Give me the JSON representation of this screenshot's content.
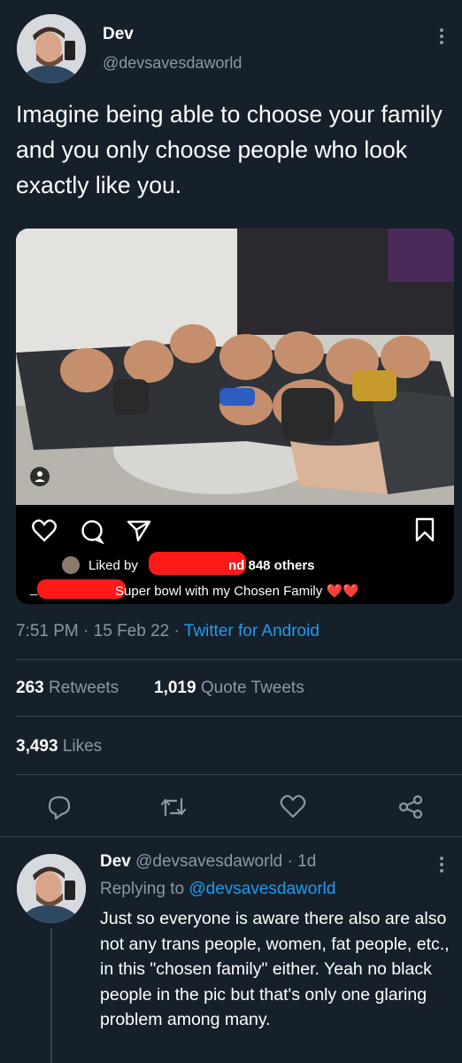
{
  "colors": {
    "background": "#15202b",
    "text": "#ffffff",
    "muted": "#8b98a5",
    "link": "#1d9bf0",
    "heart": "#e0245e",
    "redaction": "#ff1a1a"
  },
  "tweet": {
    "author_name": "Dev",
    "author_handle": "@devsavesdaworld",
    "text": "Imagine being able to choose your family and you only choose people who look exactly like you.",
    "embedded_post": {
      "liked_by_prefix": "Liked by",
      "liked_by_suffix": "nd 848 others",
      "caption": "Super bowl with my Chosen Family",
      "caption_emoji": "❤️❤️",
      "caption_prefix": "_"
    },
    "time": "7:51 PM",
    "date": "15 Feb 22",
    "separator": "·",
    "source": "Twitter for Android",
    "retweets_count": "263",
    "retweets_label": "Retweets",
    "quotes_count": "1,019",
    "quotes_label": "Quote Tweets",
    "likes_count": "3,493",
    "likes_label": "Likes",
    "actions": [
      "reply-icon",
      "retweet-icon",
      "like-icon",
      "share-icon"
    ]
  },
  "reply": {
    "author_name": "Dev",
    "author_handle": "@devsavesdaworld",
    "age": "· 1d",
    "replying_to_prefix": "Replying to",
    "replying_to_handle": "@devsavesdaworld",
    "text": "Just so everyone is aware there also are also not any trans people, women, fat people, etc., in this \"chosen family\" either. Yeah no black people in the pic but that's only one glaring problem among many."
  }
}
